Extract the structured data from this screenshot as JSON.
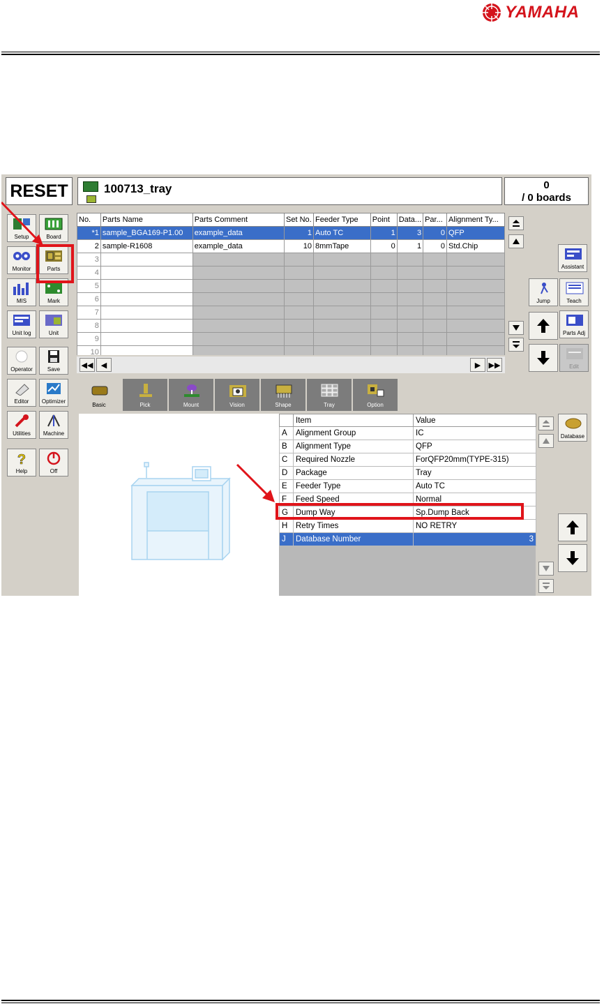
{
  "brand": {
    "logo_text": "YAMAHA",
    "logo_color": "#d4141c"
  },
  "app": {
    "reset_label": "RESET",
    "file_title": "100713_tray",
    "board_count": "0",
    "board_total": "/ 0 boards"
  },
  "toolbar": {
    "setup": "Setup",
    "board": "Board",
    "monitor": "Monitor",
    "parts": "Parts",
    "mis": "MIS",
    "mark": "Mark",
    "unitlog": "Unit log",
    "unit": "Unit",
    "operator": "Operator",
    "save": "Save",
    "editor": "Editor",
    "optimizer": "Optimizer",
    "utilities": "Utilities",
    "machine": "Machine",
    "help": "Help",
    "off": "Off"
  },
  "parts_table": {
    "columns": [
      "No.",
      "Parts Name",
      "Parts Comment",
      "Set No.",
      "Feeder Type",
      "Point",
      "Data...",
      "Par...",
      "Alignment Ty..."
    ],
    "rows": [
      {
        "no": "*1",
        "name": "sample_BGA169-P1.00",
        "comment": "example_data",
        "set": "1",
        "feeder": "Auto TC",
        "point": "1",
        "data": "3",
        "par": "0",
        "align": "QFP"
      },
      {
        "no": "2",
        "name": "sample-R1608",
        "comment": "example_data",
        "set": "10",
        "feeder": "8mmTape",
        "point": "0",
        "data": "1",
        "par": "0",
        "align": "Std.Chip"
      }
    ],
    "empty_rows": [
      "3",
      "4",
      "5",
      "6",
      "7",
      "8",
      "9",
      "10"
    ]
  },
  "right_panel": {
    "assistant": "Assistant",
    "jump": "Jump",
    "teach": "Teach",
    "parts_adj": "Parts Adj",
    "edit": "Edit",
    "database": "Database"
  },
  "tabs": [
    "Basic",
    "Pick",
    "Mount",
    "Vision",
    "Shape",
    "Tray",
    "Option"
  ],
  "detail_table": {
    "columns": [
      "",
      "Item",
      "Value"
    ],
    "rows": [
      {
        "key": "A",
        "item": "Alignment Group",
        "value": "IC"
      },
      {
        "key": "B",
        "item": "Alignment Type",
        "value": "QFP"
      },
      {
        "key": "C",
        "item": "Required Nozzle",
        "value": "ForQFP20mm(TYPE-315)"
      },
      {
        "key": "D",
        "item": "Package",
        "value": "Tray"
      },
      {
        "key": "E",
        "item": "Feeder Type",
        "value": "Auto TC"
      },
      {
        "key": "F",
        "item": "Feed Speed",
        "value": "Normal"
      },
      {
        "key": "G",
        "item": "Dump Way",
        "value": "Sp.Dump Back"
      },
      {
        "key": "H",
        "item": "Retry Times",
        "value": "NO RETRY"
      },
      {
        "key": "J",
        "item": "Database Number",
        "value": "3"
      }
    ]
  }
}
